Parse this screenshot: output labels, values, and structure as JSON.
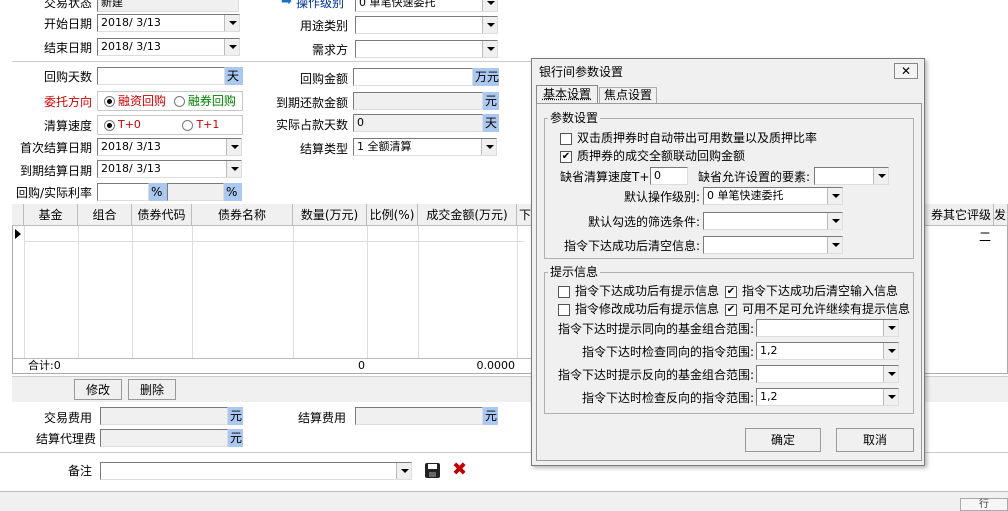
{
  "form": {
    "trade_status_label": "交易状态",
    "trade_status_value": "新建",
    "start_date_label": "开始日期",
    "start_date_value": "2018/ 3/13",
    "end_date_label": "结束日期",
    "end_date_value": "2018/ 3/13",
    "op_level_label": "操作级别",
    "op_level_value": "0  单笔快速委托",
    "usage_label": "用途类别",
    "demand_label": "需求方",
    "repo_days_label": "回购天数",
    "repo_days_unit": "天",
    "direction_label": "委托方向",
    "direction_opt1": "融资回购",
    "direction_opt2": "融券回购",
    "speed_label": "清算速度",
    "speed_opt1": "T+0",
    "speed_opt2": "T+1",
    "first_settle_label": "首次结算日期",
    "first_settle_value": "2018/ 3/13",
    "maturity_settle_label": "到期结算日期",
    "maturity_settle_value": "2018/ 3/13",
    "rate_label": "回购/实际利率",
    "pct": "%",
    "repo_amount_label": "回购金额",
    "repo_amount_unit": "万元",
    "maturity_amount_label": "到期还款金额",
    "yuan": "元",
    "actual_days_label": "实际占款天数",
    "actual_days_value": "0",
    "settle_type_label": "结算类型",
    "settle_type_value": "1  全额清算"
  },
  "grid": {
    "columns": [
      "基金",
      "组合",
      "债券代码",
      "债券名称",
      "数量(万元)",
      "比例(%)",
      "成交金额(万元)",
      "下"
    ],
    "right_columns": [
      "券其它评级二",
      "发"
    ],
    "total_label": "合计:0",
    "total_qty": "0",
    "total_amount": "0.0000"
  },
  "actions": {
    "modify": "修改",
    "delete": "删除"
  },
  "fees": {
    "trade_fee_label": "交易费用",
    "agency_fee_label": "结算代理费",
    "settle_fee_label": "结算费用",
    "yuan": "元",
    "remark_label": "备注"
  },
  "dialog": {
    "title": "银行间参数设置",
    "tabs": [
      "基本设置",
      "焦点设置"
    ],
    "params_group": "参数设置",
    "chk1": "双击质押券时自动带出可用数量以及质押比率",
    "chk2": "质押券的成交全额联动回购金额",
    "default_speed_label": "缺省清算速度T+",
    "default_speed_value": "0",
    "default_elements_label": "缺省允许设置的要素:",
    "default_level_label": "默认操作级别:",
    "default_level_value": "0  单笔快速委托",
    "default_filter_label": "默认勾选的筛选条件:",
    "clear_after_label": "指令下达成功后清空信息:",
    "hints_group": "提示信息",
    "hint1": "指令下达成功后有提示信息",
    "hint2": "指令下达成功后清空输入信息",
    "hint3": "指令修改成功后有提示信息",
    "hint4": "可用不足可允许继续有提示信息",
    "same_dir_fund_label": "指令下达时提示同向的基金组合范围:",
    "same_dir_check_label": "指令下达时检查同向的指令范围:",
    "same_dir_check_value": "1,2",
    "rev_dir_fund_label": "指令下达时提示反向的基金组合范围:",
    "rev_dir_check_label": "指令下达时检查反向的指令范围:",
    "rev_dir_check_value": "1,2",
    "ok": "确定",
    "cancel": "取消"
  },
  "status": {
    "hint": "行"
  }
}
